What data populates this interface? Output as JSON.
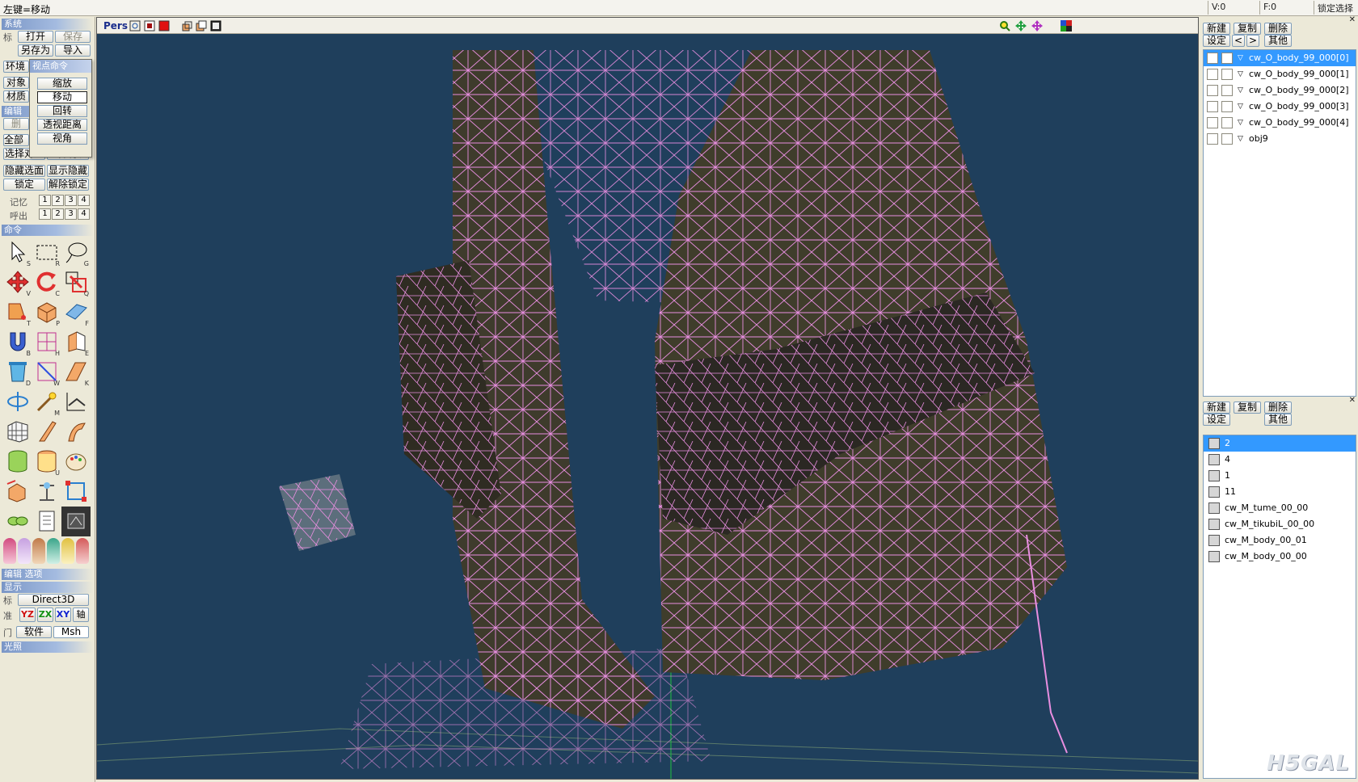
{
  "statusbar": {
    "hint": "左键=移动",
    "v": "V:0",
    "f": "F:0",
    "lock": "锁定选择"
  },
  "left": {
    "system": "系统",
    "open": "打开",
    "save": "保存",
    "saveas": "另存为",
    "import": "导入",
    "env": "环境",
    "obj": "对象",
    "mat": "材质",
    "edit": "编辑",
    "del": "删",
    "all": "全部",
    "select_obj": "选择对象",
    "select_mat": "选择材质",
    "hide_face": "隐藏选面",
    "show_hidden": "显示隐藏",
    "lock": "锁定",
    "unlock": "解除锁定",
    "memory": "记忆",
    "recall": "呼出",
    "nums": [
      "1",
      "2",
      "3",
      "4"
    ],
    "command": "命令",
    "tool_keys": [
      "S",
      "R",
      "G",
      "V",
      "C",
      "Q",
      "T",
      "P",
      "F",
      "B",
      "H",
      "E",
      "D",
      "W",
      "K",
      "",
      "M",
      "",
      "",
      "",
      "",
      "",
      "U",
      "",
      "",
      "",
      "",
      "",
      "",
      ""
    ],
    "edit_options": "编辑 选项",
    "display": "显示",
    "direct3d": "Direct3D",
    "axis_labels": [
      "YZ",
      "ZX",
      "XY",
      "轴"
    ],
    "software": "软件",
    "msh": "Msh",
    "light": "光照",
    "side_chars": [
      "标",
      "准",
      "门"
    ]
  },
  "popup": {
    "title": "视点命令",
    "items": [
      "缩放",
      "移动",
      "回转",
      "透视距离",
      "视角"
    ],
    "selected_index": 1
  },
  "viewport": {
    "mode": "Pers"
  },
  "objects_panel": {
    "new": "新建",
    "copy": "复制",
    "delete": "删除",
    "settings": "设定",
    "prev": "<",
    "next": ">",
    "other": "其他",
    "items": [
      {
        "name": "cw_O_body_99_000[0]",
        "selected": true
      },
      {
        "name": "cw_O_body_99_000[1]",
        "selected": false
      },
      {
        "name": "cw_O_body_99_000[2]",
        "selected": false
      },
      {
        "name": "cw_O_body_99_000[3]",
        "selected": false
      },
      {
        "name": "cw_O_body_99_000[4]",
        "selected": false
      },
      {
        "name": "obj9",
        "selected": false
      }
    ]
  },
  "materials_panel": {
    "new": "新建",
    "copy": "复制",
    "delete": "删除",
    "settings": "设定",
    "other": "其他",
    "items": [
      {
        "name": "2",
        "selected": true
      },
      {
        "name": "4",
        "selected": false
      },
      {
        "name": "1",
        "selected": false
      },
      {
        "name": "11",
        "selected": false
      },
      {
        "name": "cw_M_tume_00_00",
        "selected": false
      },
      {
        "name": "cw_M_tikubiL_00_00",
        "selected": false
      },
      {
        "name": "cw_M_body_00_01",
        "selected": false
      },
      {
        "name": "cw_M_body_00_00",
        "selected": false
      }
    ]
  },
  "watermark": "H5GAL"
}
